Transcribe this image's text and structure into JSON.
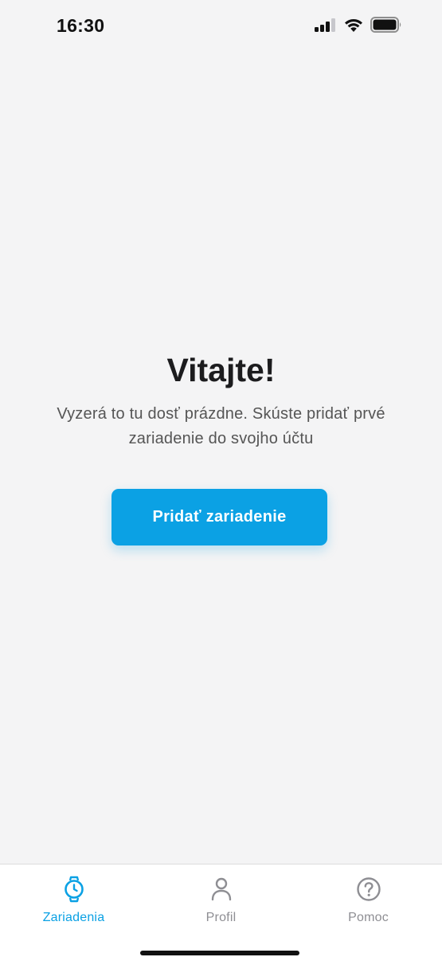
{
  "status_bar": {
    "time": "16:30"
  },
  "welcome": {
    "title": "Vitajte!",
    "message": "Vyzerá to tu dosť prázdne. Skúste pridať prvé zariadenie do svojho účtu",
    "add_button_label": "Pridať zariadenie"
  },
  "tab_bar": {
    "tabs": [
      {
        "label": "Zariadenia",
        "icon": "watch-icon",
        "active": true
      },
      {
        "label": "Profil",
        "icon": "person-icon",
        "active": false
      },
      {
        "label": "Pomoc",
        "icon": "help-circle-icon",
        "active": false
      }
    ]
  },
  "colors": {
    "accent": "#0ba1e4",
    "background": "#f4f4f5",
    "inactive": "#8e8e93"
  }
}
